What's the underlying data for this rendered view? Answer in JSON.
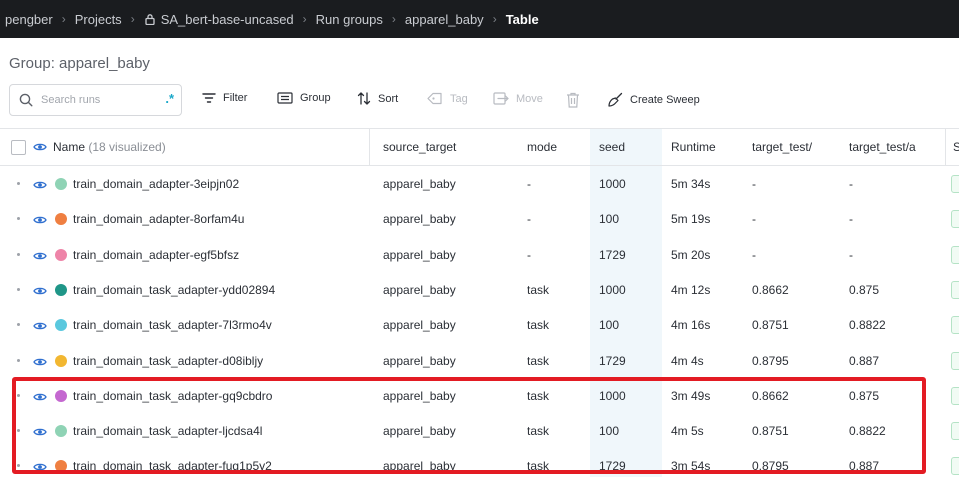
{
  "breadcrumb": {
    "user": "pengber",
    "projects": "Projects",
    "project": "SA_bert-base-uncased",
    "run_groups": "Run groups",
    "group": "apparel_baby",
    "current": "Table"
  },
  "group_title": "Group: apparel_baby",
  "toolbar": {
    "search_placeholder": "Search runs",
    "regex_symbol": ".*",
    "filter": "Filter",
    "group": "Group",
    "sort": "Sort",
    "tag": "Tag",
    "move": "Move",
    "create_sweep": "Create Sweep"
  },
  "table": {
    "headers": {
      "name": "Name",
      "visualized": "(18 visualized)",
      "source_target": "source_target",
      "mode": "mode",
      "seed": "seed",
      "runtime": "Runtime",
      "target_test_1": "target_test/",
      "target_test_2": "target_test/a",
      "next": "S"
    },
    "rows": [
      {
        "name": "train_domain_adapter-3eipjn02",
        "color": "#8fd3b5",
        "source_target": "apparel_baby",
        "mode": "-",
        "seed": "1000",
        "runtime": "5m 34s",
        "t1": "-",
        "t2": "-"
      },
      {
        "name": "train_domain_adapter-8orfam4u",
        "color": "#ef7f41",
        "source_target": "apparel_baby",
        "mode": "-",
        "seed": "100",
        "runtime": "5m 19s",
        "t1": "-",
        "t2": "-"
      },
      {
        "name": "train_domain_adapter-egf5bfsz",
        "color": "#ee84a8",
        "source_target": "apparel_baby",
        "mode": "-",
        "seed": "1729",
        "runtime": "5m 20s",
        "t1": "-",
        "t2": "-"
      },
      {
        "name": "train_domain_task_adapter-ydd02894",
        "color": "#1f9688",
        "source_target": "apparel_baby",
        "mode": "task",
        "seed": "1000",
        "runtime": "4m 12s",
        "t1": "0.8662",
        "t2": "0.875"
      },
      {
        "name": "train_domain_task_adapter-7l3rmo4v",
        "color": "#5ac8de",
        "source_target": "apparel_baby",
        "mode": "task",
        "seed": "100",
        "runtime": "4m 16s",
        "t1": "0.8751",
        "t2": "0.8822"
      },
      {
        "name": "train_domain_task_adapter-d08ibljy",
        "color": "#f2b731",
        "source_target": "apparel_baby",
        "mode": "task",
        "seed": "1729",
        "runtime": "4m 4s",
        "t1": "0.8795",
        "t2": "0.887"
      },
      {
        "name": "train_domain_task_adapter-gq9cbdro",
        "color": "#c468d0",
        "source_target": "apparel_baby",
        "mode": "task",
        "seed": "1000",
        "runtime": "3m 49s",
        "t1": "0.8662",
        "t2": "0.875"
      },
      {
        "name": "train_domain_task_adapter-ljcdsa4l",
        "color": "#8fd3b5",
        "source_target": "apparel_baby",
        "mode": "task",
        "seed": "100",
        "runtime": "4m 5s",
        "t1": "0.8751",
        "t2": "0.8822"
      },
      {
        "name": "train_domain_task_adapter-fug1p5y2",
        "color": "#ef7f41",
        "source_target": "apparel_baby",
        "mode": "task",
        "seed": "1729",
        "runtime": "3m 54s",
        "t1": "0.8795",
        "t2": "0.887"
      }
    ]
  },
  "colors": {
    "topbar": "#1a1c1f",
    "accent": "#1aa8c9",
    "highlight": "#e31b23",
    "seed_column": "#f0f7fb"
  }
}
